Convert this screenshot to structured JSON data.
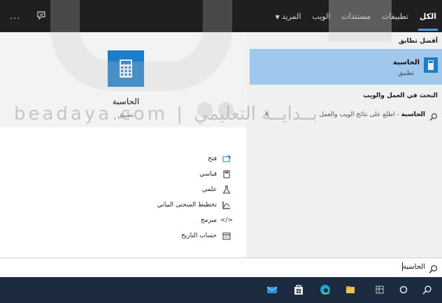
{
  "topbar": {
    "tabs": [
      {
        "label": "الكل",
        "active": true
      },
      {
        "label": "تطبيقات"
      },
      {
        "label": "مستندات"
      },
      {
        "label": "الويب"
      },
      {
        "label": "المزيد"
      }
    ],
    "more_icon": "chevron-down-icon",
    "more_options_label": "...",
    "feedback_icon": "feedback-icon"
  },
  "results": {
    "best_match_heading": "أفضل تطابق",
    "best_match": {
      "name": "الحاسبة",
      "type": "تطبيق",
      "icon": "calculator-icon"
    },
    "web_heading": "البحث في العمل والويب",
    "web_item": {
      "query": "الحاسبة",
      "suffix": " - اطلع على نتائج الويب والعمل",
      "arrow": "›"
    }
  },
  "preview": {
    "name": "الحاسبة",
    "type": "تطبيق",
    "actions": [
      {
        "label": "فتح",
        "icon": "open-icon"
      },
      {
        "label": "قياسي",
        "icon": "standard-calculator-icon"
      },
      {
        "label": "علمي",
        "icon": "scientific-flask-icon"
      },
      {
        "label": "تخطيط المنحنى البياني",
        "icon": "graphing-icon"
      },
      {
        "label": "مبرمج",
        "icon": "code-icon"
      },
      {
        "label": "حساب التاريخ",
        "icon": "calendar-icon"
      }
    ]
  },
  "search": {
    "value": "الحاسبة"
  },
  "taskbar": {
    "icons": [
      "search-icon",
      "cortana-icon",
      "task-view-icon",
      "file-explorer-icon",
      "edge-icon",
      "store-icon",
      "mail-icon"
    ]
  },
  "watermark": {
    "text": "beadaya.com | بــدايــة التعليمي"
  },
  "colors": {
    "accent": "#1e7dc8",
    "selection": "#9fc8ec",
    "taskbar": "#1c2b40",
    "topbar": "#1f1f1f"
  }
}
